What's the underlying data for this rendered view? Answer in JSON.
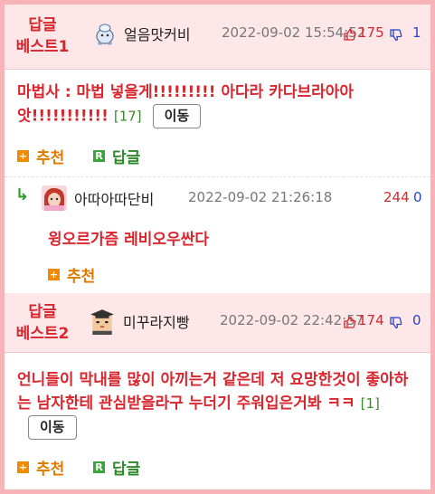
{
  "best1": {
    "label_line1": "답글",
    "label_line2": "베스트1",
    "nickname": "얼음맛커비",
    "date": "2022-09-02 15:54:52",
    "up_count": "175",
    "down_count": "1",
    "content": "마법사 : 마법 넣을게!!!!!!!!! 아다라 카다브라아아앗!!!!!!!!!!!",
    "reply_count": "[17]",
    "move_button": "이동",
    "recommend_label": "추천",
    "reply_label": "답글"
  },
  "reply1": {
    "nickname": "아따아따단비",
    "date": "2022-09-02 21:26:18",
    "up_count": "244",
    "down_count": "0",
    "content": "윙오르가즘 레비오우싼다",
    "recommend_label": "추천"
  },
  "best2": {
    "label_line1": "답글",
    "label_line2": "베스트2",
    "nickname": "미꾸라지빵",
    "date": "2022-09-02 22:42:57",
    "up_count": "174",
    "down_count": "0",
    "content": "언니들이 막내를 많이 아끼는거 같은데 저 요망한것이 좋아하는 남자한테 관심받을라구 누더기 주워입은거봐 ㅋㅋ",
    "reply_count": "[1]",
    "move_button": "이동",
    "recommend_label": "추천",
    "reply_label": "답글"
  },
  "colors": {
    "accent_red": "#d9262e",
    "header_pink": "#fde7e8",
    "border_pink": "#f6b4b8",
    "recommend_orange": "#e07b00",
    "reply_green": "#2c8a2c",
    "down_blue": "#2a43c9"
  },
  "icons": [
    "avatar-kirby",
    "avatar-girl",
    "avatar-graduate",
    "thumbs-up-icon",
    "thumbs-down-icon",
    "plus-icon",
    "reply-r-icon",
    "reply-arrow-icon"
  ]
}
